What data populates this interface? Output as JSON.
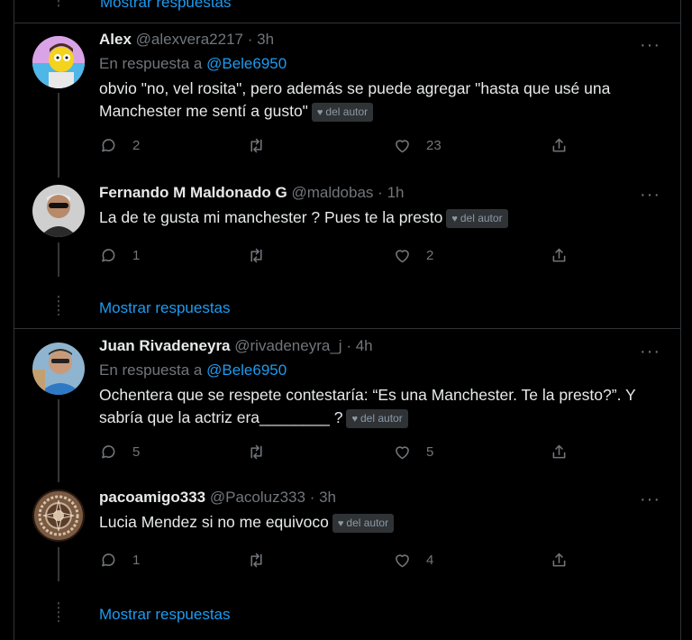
{
  "top_show_replies": "Mostrar respuestas",
  "tweets": [
    {
      "name": "Alex",
      "handle": "@alexvera2217",
      "sep": "·",
      "time": "3h",
      "reply_prefix": "En respuesta a",
      "reply_to": "@Bele6950",
      "text": "obvio \"no, vel rosita\", pero además se puede agregar \"hasta que usé una Manchester me sentí a gusto\"",
      "badge": "del autor",
      "replies": "2",
      "retweets": "",
      "likes": "23"
    },
    {
      "name": "Fernando M Maldonado G",
      "handle": "@maldobas",
      "sep": "·",
      "time": "1h",
      "text": "La de te gusta mi manchester ? Pues te la presto",
      "badge": "del autor",
      "replies": "1",
      "retweets": "",
      "likes": "2"
    },
    {
      "name": "Juan Rivadeneyra",
      "handle": "@rivadeneyra_j",
      "sep": "·",
      "time": "4h",
      "reply_prefix": "En respuesta a",
      "reply_to": "@Bele6950",
      "text": "Ochentera que se respete contestaría: “Es una Manchester. Te la presto?”. Y sabría que la actriz era________ ?",
      "badge": "del autor",
      "replies": "5",
      "retweets": "",
      "likes": "5"
    },
    {
      "name": "pacoamigo333",
      "handle": "@Pacoluz333",
      "sep": "·",
      "time": "3h",
      "text": "Lucia Mendez si no me equivoco",
      "badge": "del autor",
      "replies": "1",
      "retweets": "",
      "likes": "4"
    }
  ],
  "show_replies_1": "Mostrar respuestas",
  "show_replies_2": "Mostrar respuestas",
  "more_label": "···",
  "colors": {
    "background": "#000000",
    "link": "#1d9bf0",
    "muted": "#71767b",
    "border": "#2f3336"
  }
}
